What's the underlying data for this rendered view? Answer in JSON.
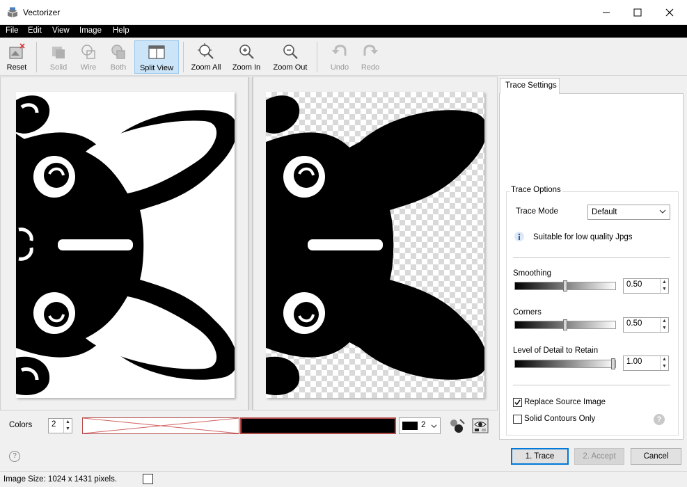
{
  "window": {
    "title": "Vectorizer"
  },
  "menu": [
    "File",
    "Edit",
    "View",
    "Image",
    "Help"
  ],
  "toolbar": {
    "reset": "Reset",
    "solid": "Solid",
    "wire": "Wire",
    "both": "Both",
    "split_view": "Split View",
    "zoom_all": "Zoom All",
    "zoom_in": "Zoom In",
    "zoom_out": "Zoom Out",
    "undo": "Undo",
    "redo": "Redo"
  },
  "colors_bar": {
    "label": "Colors",
    "count": "2",
    "palette_count": "2"
  },
  "settings": {
    "tab": "Trace Settings",
    "group_title": "Trace Options",
    "trace_mode_label": "Trace Mode",
    "trace_mode_value": "Default",
    "info_text": "Suitable for low quality Jpgs",
    "smoothing_label": "Smoothing",
    "smoothing_value": "0.50",
    "smoothing_level": 0.5,
    "corners_label": "Corners",
    "corners_value": "0.50",
    "corners_level": 0.5,
    "detail_label": "Level of Detail to Retain",
    "detail_value": "1.00",
    "detail_level": 1.0,
    "replace_source_label": "Replace Source Image",
    "replace_source_checked": true,
    "solid_contours_label": "Solid Contours Only",
    "solid_contours_checked": false
  },
  "buttons": {
    "trace": "1. Trace",
    "accept": "2. Accept",
    "cancel": "Cancel"
  },
  "status": {
    "text": "Image Size: 1024 x 1431 pixels."
  },
  "colors": {
    "menubar": "#000000",
    "selected": "#cce4f7",
    "primary_border": "#0078d7"
  }
}
